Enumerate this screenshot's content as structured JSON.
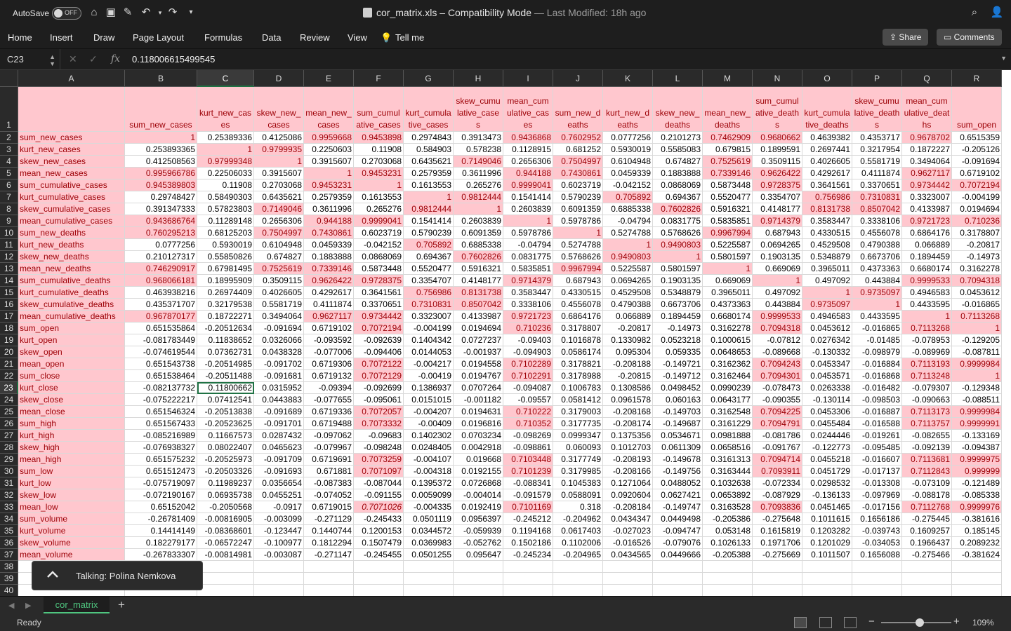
{
  "titlebar": {
    "autosave_label": "AutoSave",
    "autosave_state": "OFF",
    "filename": "cor_matrix.xls",
    "mode": "Compatibility Mode",
    "modified": "— Last Modified: 18h ago"
  },
  "ribbon": {
    "tabs": [
      "Home",
      "Insert",
      "Draw",
      "Page Layout",
      "Formulas",
      "Data",
      "Review",
      "View",
      "Tell me"
    ],
    "share": "Share",
    "comments": "Comments"
  },
  "formula_bar": {
    "name_box": "C23",
    "value": "0.118006615499545"
  },
  "grid": {
    "columns": [
      "A",
      "B",
      "C",
      "D",
      "E",
      "F",
      "G",
      "H",
      "I",
      "J",
      "K",
      "L",
      "M",
      "N",
      "O",
      "P",
      "Q",
      "R"
    ],
    "selected_column": "C",
    "selected_row": 23,
    "active_cell": "C23",
    "row_numbers": [
      "1",
      "2",
      "3",
      "4",
      "5",
      "6",
      "7",
      "8",
      "9",
      "10",
      "11",
      "12",
      "13",
      "14",
      "15",
      "16",
      "17",
      "18",
      "19",
      "20",
      "21",
      "22",
      "23",
      "24",
      "25",
      "26",
      "27",
      "28",
      "29",
      "30",
      "31",
      "32",
      "33",
      "34",
      "35",
      "36",
      "37",
      "38",
      "39",
      "40"
    ],
    "header_row": [
      "",
      "sum_new_cases",
      "kurt_new_cases",
      "skew_new_cases",
      "mean_new_cases",
      "sum_cumulative_cases",
      "kurt_cumulative_cases",
      "skew_cumulative_cases",
      "mean_cumulative_cases",
      "sum_new_deaths",
      "kurt_new_deaths",
      "skew_new_deaths",
      "mean_new_deaths",
      "sum_cumulative_deaths",
      "kurt_cumulative_deaths",
      "skew_cumulative_deaths",
      "mean_cumulative_deaths",
      "sum_open"
    ],
    "rows": [
      [
        "sum_new_cases",
        "1",
        "0.25389336",
        "0.4125086",
        "0.9959668",
        "0.9453898",
        "0.2974843",
        "0.3913473",
        "0.9436868",
        "0.7602952",
        "0.0777256",
        "0.2101273",
        "0.7462909",
        "0.9680662",
        "0.4639382",
        "0.4353717",
        "0.9678702",
        "0.6515359"
      ],
      [
        "kurt_new_cases",
        "0.253893365",
        "1",
        "0.9799935",
        "0.2250603",
        "0.11908",
        "0.584903",
        "0.578238",
        "0.1128915",
        "0.681252",
        "0.5930019",
        "0.5585083",
        "0.679815",
        "0.1899591",
        "0.2697441",
        "0.3217954",
        "0.1872227",
        "-0.205126"
      ],
      [
        "skew_new_cases",
        "0.412508563",
        "0.97999348",
        "1",
        "0.3915607",
        "0.2703068",
        "0.6435621",
        "0.7149046",
        "0.2656306",
        "0.7504997",
        "0.6104948",
        "0.674827",
        "0.7525619",
        "0.3509115",
        "0.4026605",
        "0.5581719",
        "0.3494064",
        "-0.091694"
      ],
      [
        "mean_new_cases",
        "0.995966786",
        "0.22506033",
        "0.3915607",
        "1",
        "0.9453231",
        "0.2579359",
        "0.3611996",
        "0.944188",
        "0.7430861",
        "0.0459339",
        "0.1883888",
        "0.7339146",
        "0.9626422",
        "0.4292617",
        "0.4111874",
        "0.9627117",
        "0.6719102"
      ],
      [
        "sum_cumulative_cases",
        "0.945389803",
        "0.11908",
        "0.2703068",
        "0.9453231",
        "1",
        "0.1613553",
        "0.265276",
        "0.9999041",
        "0.6023719",
        "-0.042152",
        "0.0868069",
        "0.5873448",
        "0.9728375",
        "0.3641561",
        "0.3370651",
        "0.9734442",
        "0.7072194"
      ],
      [
        "kurt_cumulative_cases",
        "0.29748427",
        "0.58490303",
        "0.6435621",
        "0.2579359",
        "0.1613553",
        "1",
        "0.9812444",
        "0.1541414",
        "0.5790239",
        "0.705892",
        "0.694367",
        "0.5520477",
        "0.3354707",
        "0.756986",
        "0.7310831",
        "0.3323007",
        "-0.004199"
      ],
      [
        "skew_cumulative_cases",
        "0.391347333",
        "0.57823803",
        "0.7149046",
        "0.3611996",
        "0.265276",
        "0.9812444",
        "1",
        "0.2603839",
        "0.6091359",
        "0.6885338",
        "0.7602826",
        "0.5916321",
        "0.4148177",
        "0.8131738",
        "0.8507042",
        "0.4133987",
        "0.0194694"
      ],
      [
        "mean_cumulative_cases",
        "0.943686764",
        "0.11289148",
        "0.2656306",
        "0.944188",
        "0.9999041",
        "0.1541414",
        "0.2603839",
        "1",
        "0.5978786",
        "-0.04794",
        "0.0831775",
        "0.5835851",
        "0.9714379",
        "0.3583447",
        "0.3338106",
        "0.9721723",
        "0.710236"
      ],
      [
        "sum_new_deaths",
        "0.760295213",
        "0.68125203",
        "0.7504997",
        "0.7430861",
        "0.6023719",
        "0.5790239",
        "0.6091359",
        "0.5978786",
        "1",
        "0.5274788",
        "0.5768626",
        "0.9967994",
        "0.687943",
        "0.4330515",
        "0.4556078",
        "0.6864176",
        "0.3178807"
      ],
      [
        "kurt_new_deaths",
        "0.0777256",
        "0.5930019",
        "0.6104948",
        "0.0459339",
        "-0.042152",
        "0.705892",
        "0.6885338",
        "-0.04794",
        "0.5274788",
        "1",
        "0.9490803",
        "0.5225587",
        "0.0694265",
        "0.4529508",
        "0.4790388",
        "0.066889",
        "-0.20817"
      ],
      [
        "skew_new_deaths",
        "0.210127317",
        "0.55850826",
        "0.674827",
        "0.1883888",
        "0.0868069",
        "0.694367",
        "0.7602826",
        "0.0831775",
        "0.5768626",
        "0.9490803",
        "1",
        "0.5801597",
        "0.1903135",
        "0.5348879",
        "0.6673706",
        "0.1894459",
        "-0.14973"
      ],
      [
        "mean_new_deaths",
        "0.746290917",
        "0.67981495",
        "0.7525619",
        "0.7339146",
        "0.5873448",
        "0.5520477",
        "0.5916321",
        "0.5835851",
        "0.9967994",
        "0.5225587",
        "0.5801597",
        "1",
        "0.669069",
        "0.3965011",
        "0.4373363",
        "0.6680174",
        "0.3162278"
      ],
      [
        "sum_cumulative_deaths",
        "0.968066181",
        "0.18995909",
        "0.3509115",
        "0.9626422",
        "0.9728375",
        "0.3354707",
        "0.4148177",
        "0.9714379",
        "0.687943",
        "0.0694265",
        "0.1903135",
        "0.669069",
        "1",
        "0.497092",
        "0.443884",
        "0.9999533",
        "0.7094318"
      ],
      [
        "kurt_cumulative_deaths",
        "0.463938216",
        "0.26974409",
        "0.4026605",
        "0.4292617",
        "0.3641561",
        "0.756986",
        "0.8131738",
        "0.3583447",
        "0.4330515",
        "0.4529508",
        "0.5348879",
        "0.3965011",
        "0.497092",
        "1",
        "0.9735097",
        "0.4946583",
        "0.0453612"
      ],
      [
        "skew_cumulative_deaths",
        "0.435371707",
        "0.32179538",
        "0.5581719",
        "0.4111874",
        "0.3370651",
        "0.7310831",
        "0.8507042",
        "0.3338106",
        "0.4556078",
        "0.4790388",
        "0.6673706",
        "0.4373363",
        "0.443884",
        "0.9735097",
        "1",
        "0.4433595",
        "-0.016865"
      ],
      [
        "mean_cumulative_deaths",
        "0.967870177",
        "0.18722271",
        "0.3494064",
        "0.9627117",
        "0.9734442",
        "0.3323007",
        "0.4133987",
        "0.9721723",
        "0.6864176",
        "0.066889",
        "0.1894459",
        "0.6680174",
        "0.9999533",
        "0.4946583",
        "0.4433595",
        "1",
        "0.7113268"
      ],
      [
        "sum_open",
        "0.651535864",
        "-0.20512634",
        "-0.091694",
        "0.6719102",
        "0.7072194",
        "-0.004199",
        "0.0194694",
        "0.710236",
        "0.3178807",
        "-0.20817",
        "-0.14973",
        "0.3162278",
        "0.7094318",
        "0.0453612",
        "-0.016865",
        "0.7113268",
        "1"
      ],
      [
        "kurt_open",
        "-0.081783449",
        "0.11838652",
        "0.0326066",
        "-0.093592",
        "-0.092639",
        "0.1404342",
        "0.0727237",
        "-0.09403",
        "0.1016878",
        "0.1330982",
        "0.0523218",
        "0.1000615",
        "-0.07812",
        "0.0276342",
        "-0.01485",
        "-0.078953",
        "-0.129205"
      ],
      [
        "skew_open",
        "-0.074619544",
        "0.07362731",
        "0.0438328",
        "-0.077006",
        "-0.094406",
        "0.0144053",
        "-0.001937",
        "-0.094903",
        "0.0586174",
        "0.095304",
        "0.059335",
        "0.0648653",
        "-0.089668",
        "-0.130332",
        "-0.098979",
        "-0.089969",
        "-0.087811"
      ],
      [
        "mean_open",
        "0.651543738",
        "-0.20514985",
        "-0.091702",
        "0.6719306",
        "0.7072122",
        "-0.004217",
        "0.0194558",
        "0.7102289",
        "0.3178821",
        "-0.208188",
        "-0.149721",
        "0.3162362",
        "0.7094243",
        "0.0453347",
        "-0.016884",
        "0.7113193",
        "0.9999984"
      ],
      [
        "sum_close",
        "0.651538464",
        "-0.20511488",
        "-0.091681",
        "0.6719132",
        "0.7072129",
        "-0.00419",
        "0.0194767",
        "0.7102291",
        "0.3178988",
        "-0.20815",
        "-0.149712",
        "0.3162464",
        "0.7094301",
        "0.0453571",
        "-0.016868",
        "0.7113248",
        "1"
      ],
      [
        "kurt_close",
        "-0.082137732",
        "0.11800662",
        "0.0315952",
        "-0.09394",
        "-0.092699",
        "0.1386937",
        "0.0707264",
        "-0.094087",
        "0.1006783",
        "0.1308586",
        "0.0498452",
        "0.0990239",
        "-0.078473",
        "0.0263338",
        "-0.016482",
        "-0.079307",
        "-0.129348"
      ],
      [
        "skew_close",
        "-0.075222217",
        "0.07412541",
        "0.0443883",
        "-0.077655",
        "-0.095061",
        "0.0151015",
        "-0.001182",
        "-0.09557",
        "0.0581412",
        "0.0961578",
        "0.060163",
        "0.0643177",
        "-0.090355",
        "-0.130114",
        "-0.098503",
        "-0.090663",
        "-0.088511"
      ],
      [
        "mean_close",
        "0.651546324",
        "-0.20513838",
        "-0.091689",
        "0.6719336",
        "0.7072057",
        "-0.004207",
        "0.0194631",
        "0.710222",
        "0.3179003",
        "-0.208168",
        "-0.149703",
        "0.3162548",
        "0.7094225",
        "0.0453306",
        "-0.016887",
        "0.7113173",
        "0.9999984"
      ],
      [
        "sum_high",
        "0.651567433",
        "-0.20523625",
        "-0.091701",
        "0.6719488",
        "0.7073332",
        "-0.00409",
        "0.0196816",
        "0.710352",
        "0.3177735",
        "-0.208174",
        "-0.149687",
        "0.3161229",
        "0.7094791",
        "0.0455484",
        "-0.016588",
        "0.7113757",
        "0.9999991"
      ],
      [
        "kurt_high",
        "-0.085216989",
        "0.11667573",
        "0.0287432",
        "-0.097062",
        "-0.09683",
        "0.1402302",
        "0.0703234",
        "-0.098269",
        "0.0999347",
        "0.1375356",
        "0.0534671",
        "0.0981888",
        "-0.081786",
        "0.0244446",
        "-0.019261",
        "-0.082655",
        "-0.133169"
      ],
      [
        "skew_high",
        "-0.076938327",
        "0.08022407",
        "0.0465623",
        "-0.079967",
        "-0.098248",
        "0.0248405",
        "0.0042918",
        "-0.098861",
        "0.060093",
        "0.1012703",
        "0.0611309",
        "0.0658516",
        "-0.091767",
        "-0.122773",
        "-0.095485",
        "-0.092139",
        "-0.094387"
      ],
      [
        "mean_high",
        "0.651575232",
        "-0.20525973",
        "-0.091709",
        "0.6719691",
        "0.7073259",
        "-0.004107",
        "0.019668",
        "0.7103448",
        "0.3177749",
        "-0.208193",
        "-0.149678",
        "0.3161313",
        "0.7094714",
        "0.0455218",
        "-0.016607",
        "0.7113681",
        "0.9999975"
      ],
      [
        "sum_low",
        "0.651512473",
        "-0.20503326",
        "-0.091693",
        "0.671881",
        "0.7071097",
        "-0.004318",
        "0.0192155",
        "0.7101239",
        "0.3179985",
        "-0.208166",
        "-0.149756",
        "0.3163444",
        "0.7093911",
        "0.0451729",
        "-0.017137",
        "0.7112843",
        "0.999999"
      ],
      [
        "kurt_low",
        "-0.075719097",
        "0.11989237",
        "0.0356654",
        "-0.087383",
        "-0.087044",
        "0.1395372",
        "0.0726868",
        "-0.088341",
        "0.1045383",
        "0.1271064",
        "0.0488052",
        "0.1032638",
        "-0.072334",
        "0.0298532",
        "-0.013308",
        "-0.073109",
        "-0.121489"
      ],
      [
        "skew_low",
        "-0.072190167",
        "0.06935738",
        "0.0455251",
        "-0.074052",
        "-0.091155",
        "0.0059099",
        "-0.004014",
        "-0.091579",
        "0.0588091",
        "0.0920604",
        "0.0627421",
        "0.0653892",
        "-0.087929",
        "-0.136133",
        "-0.097969",
        "-0.088178",
        "-0.085338"
      ],
      [
        "mean_low",
        "0.65152042",
        "-0.2050568",
        "-0.0917",
        "0.6719015",
        "0.7071026",
        "-0.004335",
        "0.0192419",
        "0.7101169",
        "0.318",
        "-0.208184",
        "-0.149747",
        "0.3163528",
        "0.7093836",
        "0.0451465",
        "-0.017156",
        "0.7112768",
        "0.9999976"
      ],
      [
        "sum_volume",
        "-0.26781409",
        "-0.00816905",
        "-0.003099",
        "-0.271129",
        "-0.245433",
        "0.0501119",
        "0.0956397",
        "-0.245212",
        "-0.204962",
        "0.0434347",
        "0.0449498",
        "-0.205386",
        "-0.275648",
        "0.1011615",
        "0.1656186",
        "-0.275445",
        "-0.381616"
      ],
      [
        "kurt_volume",
        "0.14414149",
        "-0.08368601",
        "-0.123447",
        "0.1440744",
        "0.1200153",
        "0.0344572",
        "-0.059939",
        "0.1194168",
        "0.0617403",
        "-0.027023",
        "-0.094747",
        "0.053148",
        "0.1615819",
        "0.1203282",
        "-0.039743",
        "0.1609257",
        "0.185145"
      ],
      [
        "skew_volume",
        "0.182279177",
        "-0.06572247",
        "-0.100977",
        "0.1812294",
        "0.1507479",
        "0.0369983",
        "-0.052762",
        "0.1502186",
        "0.1102006",
        "-0.016526",
        "-0.079076",
        "0.1026133",
        "0.1971706",
        "0.1201029",
        "-0.034053",
        "0.1966437",
        "0.2089232"
      ],
      [
        "mean_volume",
        "-0.267833307",
        "-0.00814981",
        "-0.003087",
        "-0.271147",
        "-0.245455",
        "0.0501255",
        "0.095647",
        "-0.245234",
        "-0.204965",
        "0.0434565",
        "0.0449666",
        "-0.205388",
        "-0.275669",
        "0.1011507",
        "0.1656088",
        "-0.275466",
        "-0.381624"
      ]
    ],
    "highlight_color": "#ffc7ce",
    "highlight_text_color": "#9c0006"
  },
  "toast": {
    "text": "Talking: Polina Nemkova"
  },
  "sheets": {
    "active": "cor_matrix",
    "add": "+"
  },
  "status": {
    "ready": "Ready",
    "zoom": "109%",
    "zoom_level": 0.55
  }
}
